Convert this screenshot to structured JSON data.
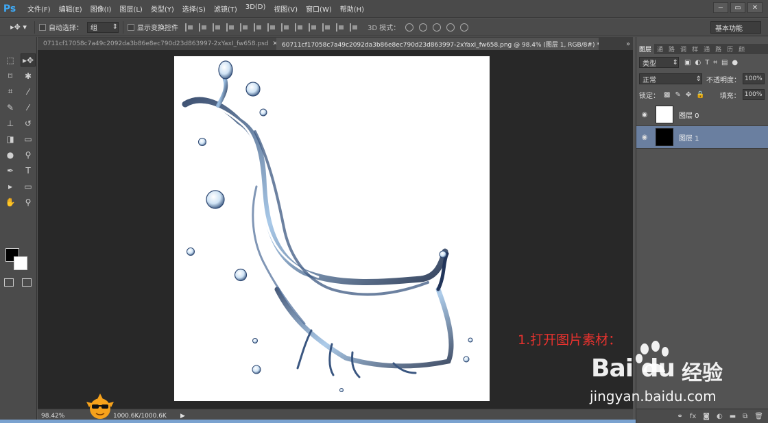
{
  "app": {
    "logo": "Ps"
  },
  "menu": [
    "文件(F)",
    "编辑(E)",
    "图像(I)",
    "图层(L)",
    "类型(Y)",
    "选择(S)",
    "滤镜(T)",
    "3D(D)",
    "视图(V)",
    "窗口(W)",
    "帮助(H)"
  ],
  "window_controls": [
    "−",
    "▭",
    "✕"
  ],
  "options": {
    "auto_select_label": "自动选择：",
    "auto_select_value": "组",
    "show_transform_label": "显示变换控件",
    "mode3d_label": "3D 模式：",
    "workspace": "基本功能"
  },
  "tabs": [
    {
      "title": "0711cf17058c7a49c2092da3b86e8ec790d23d863997-2xYaxI_fw658.psd",
      "close": "✕",
      "active": false
    },
    {
      "title": "60711cf17058c7a49c2092da3b86e8ec790d23d863997-2xYaxI_fw658.png @ 98.4% (图层 1, RGB/8#) *",
      "close": "✕",
      "active": true
    }
  ],
  "status": {
    "zoom": "98.42%",
    "doc_size": "1000.6K/1000.6K",
    "arrow": "▶"
  },
  "panel": {
    "collapse": "»",
    "tabs": [
      "图层",
      "通",
      "路",
      "调",
      "样",
      "通",
      "路",
      "历",
      "颜"
    ],
    "filter_kind": "类型",
    "blend_mode": "正常",
    "opacity_label": "不透明度：",
    "opacity_value": "100%",
    "lock_label": "锁定：",
    "fill_label": "填充：",
    "fill_value": "100%",
    "layers": [
      {
        "name": "图层 0",
        "thumb": "white",
        "selected": false
      },
      {
        "name": "图层 1",
        "thumb": "black",
        "selected": true
      }
    ]
  },
  "annotation": "1.打开图片素材：",
  "watermark": {
    "brand": "Bai  du",
    "brand2": "经验",
    "url": "jingyan.baidu.com"
  }
}
